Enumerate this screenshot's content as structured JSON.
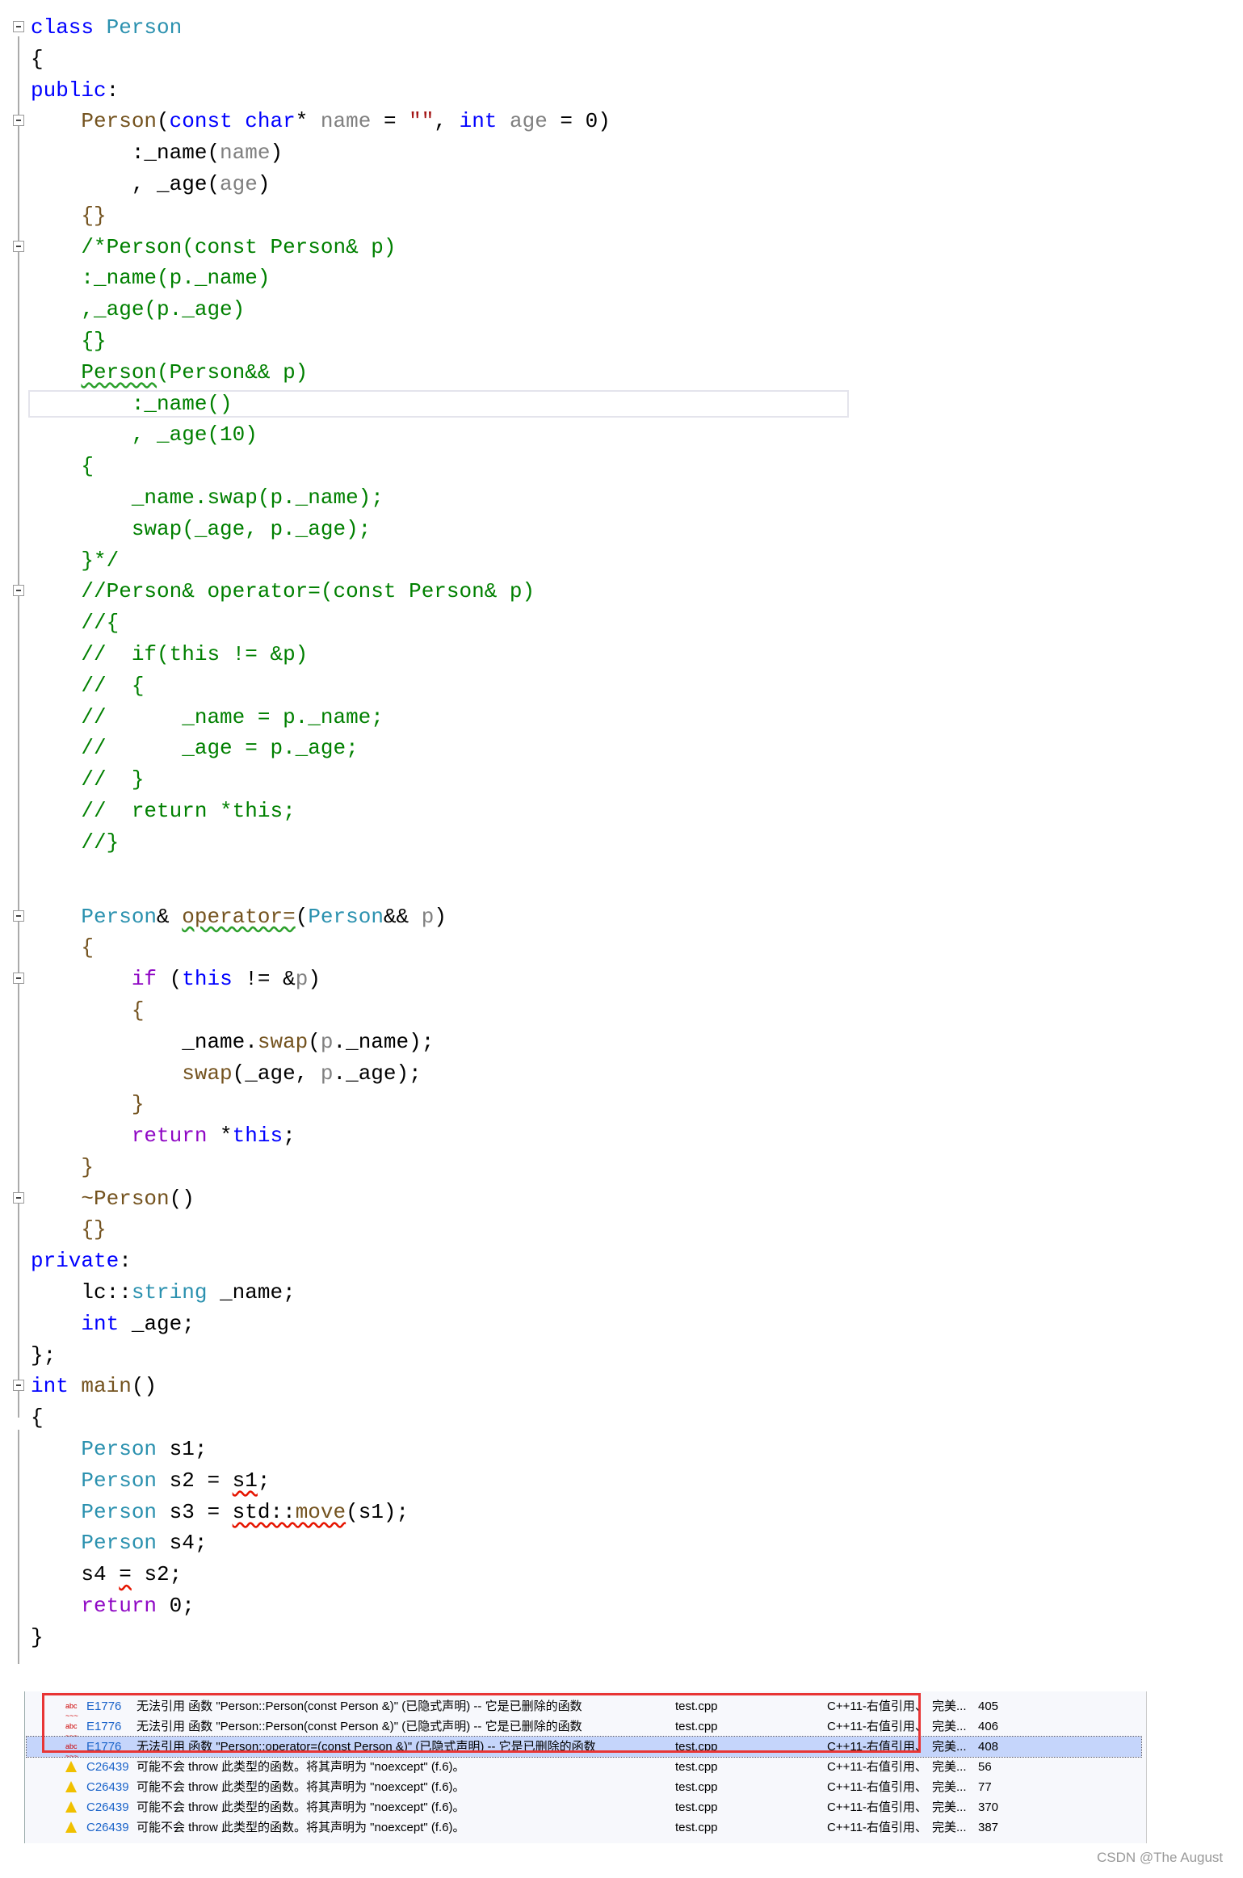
{
  "editor": {
    "lines": [
      {
        "fold": true,
        "indent": 0,
        "tokens": [
          [
            "class",
            "kw"
          ],
          [
            " ",
            "tx"
          ],
          [
            "Person",
            "ty"
          ]
        ]
      },
      {
        "indent": 0,
        "tokens": [
          [
            "{",
            "tx"
          ]
        ]
      },
      {
        "indent": 0,
        "tokens": [
          [
            "public",
            "kw"
          ],
          [
            ":",
            "tx"
          ]
        ]
      },
      {
        "fold": true,
        "indent": 4,
        "tokens": [
          [
            "Person",
            "fn"
          ],
          [
            "(",
            "tx"
          ],
          [
            "const",
            "kw"
          ],
          [
            " ",
            "tx"
          ],
          [
            "char",
            "kw"
          ],
          [
            "* ",
            "tx"
          ],
          [
            "name",
            "pa"
          ],
          [
            " = ",
            "tx"
          ],
          [
            "\"\"",
            "st"
          ],
          [
            ", ",
            "tx"
          ],
          [
            "int",
            "kw"
          ],
          [
            " ",
            "tx"
          ],
          [
            "age",
            "pa"
          ],
          [
            " = 0)",
            "tx"
          ]
        ]
      },
      {
        "indent": 8,
        "tokens": [
          [
            ":_name(",
            "tx"
          ],
          [
            "name",
            "pa"
          ],
          [
            ")",
            "tx"
          ]
        ]
      },
      {
        "indent": 8,
        "tokens": [
          [
            ", _age(",
            "tx"
          ],
          [
            "age",
            "pa"
          ],
          [
            ")",
            "tx"
          ]
        ]
      },
      {
        "indent": 4,
        "tokens": [
          [
            "{}",
            "fn"
          ]
        ]
      },
      {
        "fold": true,
        "indent": 4,
        "tokens": [
          [
            "/*Person(const Person& p)",
            "cm"
          ]
        ]
      },
      {
        "indent": 4,
        "tokens": [
          [
            ":_name(p._name)",
            "cm"
          ]
        ]
      },
      {
        "indent": 4,
        "tokens": [
          [
            ",_age(p._age)",
            "cm"
          ]
        ]
      },
      {
        "indent": 4,
        "tokens": [
          [
            "{}",
            "cm"
          ]
        ]
      },
      {
        "indent": 4,
        "tokens": [
          [
            "Person",
            "cm sq-g"
          ],
          [
            "(Person&& p)",
            "cm"
          ]
        ]
      },
      {
        "indent": 8,
        "current": true,
        "tokens": [
          [
            ":_name()",
            "cm"
          ]
        ]
      },
      {
        "indent": 8,
        "tokens": [
          [
            ", _age(10)",
            "cm"
          ]
        ]
      },
      {
        "indent": 4,
        "tokens": [
          [
            "{",
            "cm"
          ]
        ]
      },
      {
        "indent": 8,
        "tokens": [
          [
            "_name.swap(p._name);",
            "cm"
          ]
        ]
      },
      {
        "indent": 8,
        "tokens": [
          [
            "swap(_age, p._age);",
            "cm"
          ]
        ]
      },
      {
        "indent": 4,
        "tokens": [
          [
            "}*/",
            "cm"
          ]
        ]
      },
      {
        "fold": true,
        "indent": 4,
        "tokens": [
          [
            "//Person& operator=(const Person& p)",
            "cm"
          ]
        ]
      },
      {
        "indent": 4,
        "tokens": [
          [
            "//{",
            "cm"
          ]
        ]
      },
      {
        "indent": 4,
        "tokens": [
          [
            "//  if(this != &p)",
            "cm"
          ]
        ]
      },
      {
        "indent": 4,
        "tokens": [
          [
            "//  {",
            "cm"
          ]
        ]
      },
      {
        "indent": 4,
        "tokens": [
          [
            "//      _name = p._name;",
            "cm"
          ]
        ]
      },
      {
        "indent": 4,
        "tokens": [
          [
            "//      _age = p._age;",
            "cm"
          ]
        ]
      },
      {
        "indent": 4,
        "tokens": [
          [
            "//  }",
            "cm"
          ]
        ]
      },
      {
        "indent": 4,
        "tokens": [
          [
            "//  return *this;",
            "cm"
          ]
        ]
      },
      {
        "indent": 4,
        "tokens": [
          [
            "//}",
            "cm"
          ]
        ]
      },
      {
        "blank": true,
        "indent": 0,
        "tokens": []
      },
      {
        "fold": true,
        "indent": 4,
        "tokens": [
          [
            "Person",
            "ty"
          ],
          [
            "& ",
            "tx"
          ],
          [
            "operator=",
            "fn sq-g"
          ],
          [
            "(",
            "tx"
          ],
          [
            "Person",
            "ty"
          ],
          [
            "&& ",
            "tx"
          ],
          [
            "p",
            "pa"
          ],
          [
            ")",
            "tx"
          ]
        ]
      },
      {
        "indent": 4,
        "tokens": [
          [
            "{",
            "fn"
          ]
        ]
      },
      {
        "fold": true,
        "indent": 8,
        "tokens": [
          [
            "if",
            "ctl"
          ],
          [
            " (",
            "tx"
          ],
          [
            "this",
            "kw"
          ],
          [
            " != &",
            "tx"
          ],
          [
            "p",
            "pa"
          ],
          [
            ")",
            "tx"
          ]
        ]
      },
      {
        "indent": 8,
        "tokens": [
          [
            "{",
            "fn"
          ]
        ]
      },
      {
        "indent": 12,
        "tokens": [
          [
            "_name.",
            "tx"
          ],
          [
            "swap",
            "fn"
          ],
          [
            "(",
            "tx"
          ],
          [
            "p",
            "pa"
          ],
          [
            "._name);",
            "tx"
          ]
        ]
      },
      {
        "indent": 12,
        "tokens": [
          [
            "swap",
            "fn"
          ],
          [
            "(_age, ",
            "tx"
          ],
          [
            "p",
            "pa"
          ],
          [
            "._age);",
            "tx"
          ]
        ]
      },
      {
        "indent": 8,
        "tokens": [
          [
            "}",
            "fn"
          ]
        ]
      },
      {
        "indent": 8,
        "tokens": [
          [
            "return",
            "ctl"
          ],
          [
            " *",
            "tx"
          ],
          [
            "this",
            "kw"
          ],
          [
            ";",
            "tx"
          ]
        ]
      },
      {
        "indent": 4,
        "tokens": [
          [
            "}",
            "fn"
          ]
        ]
      },
      {
        "fold": true,
        "indent": 4,
        "tokens": [
          [
            "~Person",
            "fn"
          ],
          [
            "()",
            "tx"
          ]
        ]
      },
      {
        "indent": 4,
        "tokens": [
          [
            "{}",
            "fn"
          ]
        ]
      },
      {
        "indent": 0,
        "tokens": [
          [
            "private",
            "kw"
          ],
          [
            ":",
            "tx"
          ]
        ]
      },
      {
        "indent": 4,
        "tokens": [
          [
            "lc::",
            "tx"
          ],
          [
            "string",
            "ty"
          ],
          [
            " _name;",
            "tx"
          ]
        ]
      },
      {
        "indent": 4,
        "tokens": [
          [
            "int",
            "kw"
          ],
          [
            " _age;",
            "tx"
          ]
        ]
      },
      {
        "indent": 0,
        "tokens": [
          [
            "};",
            "tx"
          ]
        ]
      },
      {
        "fold": true,
        "indent": 0,
        "tokens": [
          [
            "int",
            "kw"
          ],
          [
            " ",
            "tx"
          ],
          [
            "main",
            "fn"
          ],
          [
            "()",
            "tx"
          ]
        ]
      },
      {
        "indent": 0,
        "tokens": [
          [
            "{",
            "tx"
          ]
        ]
      },
      {
        "indent": 4,
        "tokens": [
          [
            "Person",
            "ty"
          ],
          [
            " s1;",
            "tx"
          ]
        ]
      },
      {
        "indent": 4,
        "tokens": [
          [
            "Person",
            "ty"
          ],
          [
            " s2 = ",
            "tx"
          ],
          [
            "s1",
            "tx sq-r"
          ],
          [
            ";",
            "tx"
          ]
        ]
      },
      {
        "indent": 4,
        "tokens": [
          [
            "Person",
            "ty"
          ],
          [
            " s3 = ",
            "tx"
          ],
          [
            "std::",
            "tx sq-r"
          ],
          [
            "move",
            "fn sq-r"
          ],
          [
            "(s1);",
            "tx"
          ]
        ]
      },
      {
        "indent": 4,
        "tokens": [
          [
            "Person",
            "ty"
          ],
          [
            " s4;",
            "tx"
          ]
        ]
      },
      {
        "indent": 4,
        "tokens": [
          [
            "s4 ",
            "tx"
          ],
          [
            "=",
            "tx sq-r"
          ],
          [
            " s2;",
            "tx"
          ]
        ]
      },
      {
        "indent": 4,
        "tokens": [
          [
            "return",
            "ctl"
          ],
          [
            " 0;",
            "tx"
          ]
        ]
      },
      {
        "indent": 0,
        "tokens": [
          [
            "}",
            "tx"
          ]
        ]
      }
    ]
  },
  "error_list": {
    "rows": [
      {
        "icon": "error-squiggle-icon",
        "code": "E1776",
        "description": "无法引用 函数 \"Person::Person(const Person &)\" (已隐式声明) -- 它是已删除的函数",
        "file": "test.cpp",
        "project": "C++11-右值引用、",
        "suppression": "完美...",
        "line": "405"
      },
      {
        "icon": "error-squiggle-icon",
        "code": "E1776",
        "description": "无法引用 函数 \"Person::Person(const Person &)\" (已隐式声明) -- 它是已删除的函数",
        "file": "test.cpp",
        "project": "C++11-右值引用、",
        "suppression": "完美...",
        "line": "406"
      },
      {
        "icon": "error-squiggle-icon",
        "code": "E1776",
        "description": "无法引用 函数 \"Person::operator=(const Person &)\" (已隐式声明) -- 它是已删除的函数",
        "file": "test.cpp",
        "project": "C++11-右值引用、",
        "suppression": "完美...",
        "line": "408",
        "selected": true
      },
      {
        "icon": "warning-icon",
        "code": "C26439",
        "description": "可能不会 throw 此类型的函数。将其声明为 \"noexcept\" (f.6)。",
        "file": "test.cpp",
        "project": "C++11-右值引用、",
        "suppression": "完美...",
        "line": "56"
      },
      {
        "icon": "warning-icon",
        "code": "C26439",
        "description": "可能不会 throw 此类型的函数。将其声明为 \"noexcept\" (f.6)。",
        "file": "test.cpp",
        "project": "C++11-右值引用、",
        "suppression": "完美...",
        "line": "77"
      },
      {
        "icon": "warning-icon",
        "code": "C26439",
        "description": "可能不会 throw 此类型的函数。将其声明为 \"noexcept\" (f.6)。",
        "file": "test.cpp",
        "project": "C++11-右值引用、",
        "suppression": "完美...",
        "line": "370"
      },
      {
        "icon": "warning-icon",
        "code": "C26439",
        "description": "可能不会 throw 此类型的函数。将其声明为 \"noexcept\" (f.6)。",
        "file": "test.cpp",
        "project": "C++11-右值引用、",
        "suppression": "完美...",
        "line": "387"
      }
    ],
    "highlight_color": "#e83535"
  },
  "watermark": "CSDN @The   August"
}
